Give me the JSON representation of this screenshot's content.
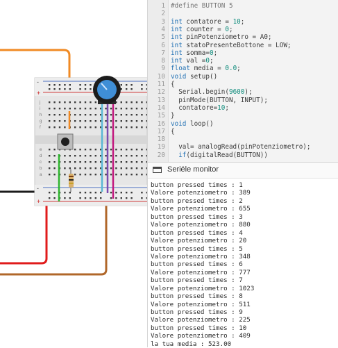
{
  "editor": {
    "lines": [
      {
        "num": "1",
        "parts": [
          {
            "t": "#define BUTTON 5",
            "c": "c"
          }
        ]
      },
      {
        "num": "2",
        "parts": []
      },
      {
        "num": "3",
        "parts": [
          {
            "t": "int",
            "c": "k"
          },
          {
            "t": " contatore = "
          },
          {
            "t": "10",
            "c": "n"
          },
          {
            "t": ";"
          }
        ]
      },
      {
        "num": "4",
        "parts": [
          {
            "t": "int",
            "c": "k"
          },
          {
            "t": " counter = "
          },
          {
            "t": "0",
            "c": "n"
          },
          {
            "t": ";"
          }
        ]
      },
      {
        "num": "5",
        "parts": [
          {
            "t": "int",
            "c": "k"
          },
          {
            "t": " pinPotenziometro = A0;"
          }
        ]
      },
      {
        "num": "6",
        "parts": [
          {
            "t": "int",
            "c": "k"
          },
          {
            "t": " statoPresenteBottone = LOW;"
          }
        ]
      },
      {
        "num": "7",
        "parts": [
          {
            "t": "int",
            "c": "k"
          },
          {
            "t": " somma="
          },
          {
            "t": "0",
            "c": "n"
          },
          {
            "t": ";"
          }
        ]
      },
      {
        "num": "8",
        "parts": [
          {
            "t": "int",
            "c": "k"
          },
          {
            "t": " val ="
          },
          {
            "t": "0",
            "c": "n"
          },
          {
            "t": ";"
          }
        ]
      },
      {
        "num": "9",
        "parts": [
          {
            "t": "float",
            "c": "k"
          },
          {
            "t": " media = "
          },
          {
            "t": "0.0",
            "c": "n"
          },
          {
            "t": ";"
          }
        ]
      },
      {
        "num": "10",
        "parts": [
          {
            "t": "void",
            "c": "k"
          },
          {
            "t": " setup()"
          }
        ]
      },
      {
        "num": "11",
        "parts": [
          {
            "t": "{"
          }
        ]
      },
      {
        "num": "12",
        "parts": [
          {
            "t": "  Serial.begin("
          },
          {
            "t": "9600",
            "c": "n"
          },
          {
            "t": ");"
          }
        ]
      },
      {
        "num": "13",
        "parts": [
          {
            "t": "  pinMode(BUTTON, INPUT);"
          }
        ]
      },
      {
        "num": "14",
        "parts": [
          {
            "t": "  contatore="
          },
          {
            "t": "10",
            "c": "n"
          },
          {
            "t": ";"
          }
        ]
      },
      {
        "num": "15",
        "parts": [
          {
            "t": "}"
          }
        ]
      },
      {
        "num": "16",
        "parts": [
          {
            "t": "void",
            "c": "k"
          },
          {
            "t": " loop()"
          }
        ]
      },
      {
        "num": "17",
        "parts": [
          {
            "t": "{"
          }
        ]
      },
      {
        "num": "18",
        "parts": []
      },
      {
        "num": "19",
        "parts": [
          {
            "t": "  val= analogRead(pinPotenziometro);"
          }
        ]
      },
      {
        "num": "20",
        "parts": [
          {
            "t": "  "
          },
          {
            "t": "if",
            "c": "k"
          },
          {
            "t": "(digitalRead(BUTTON))"
          }
        ]
      }
    ]
  },
  "monitor": {
    "title": "Seriële monitor",
    "icon": "serial-monitor-icon",
    "lines": [
      "button pressed times : 1",
      "Valore potenziometro : 389",
      "button pressed times : 2",
      "Valore potenziometro : 655",
      "button pressed times : 3",
      "Valore potenziometro : 880",
      "button pressed times : 4",
      "Valore potenziometro : 20",
      "button pressed times : 5",
      "Valore potenziometro : 348",
      "button pressed times : 6",
      "Valore potenziometro : 777",
      "button pressed times : 7",
      "Valore potenziometro : 1023",
      "button pressed times : 8",
      "Valore potenziometro : 511",
      "button pressed times : 9",
      "Valore potenziometro : 225",
      "button pressed times : 10",
      "Valore potenziometro : 409",
      "la tua media : 523.00"
    ]
  },
  "breadboard": {
    "row_letters_top": [
      "j",
      "i",
      "h",
      "g",
      "f"
    ],
    "row_letters_bottom": [
      "e",
      "d",
      "c",
      "b",
      "a"
    ],
    "plus": "+",
    "minus": "-"
  },
  "colors": {
    "wire_orange": "#f08a24",
    "wire_black": "#1b1b1b",
    "wire_red": "#e01b1b",
    "wire_brown": "#b0672a",
    "wire_green": "#2fb52f",
    "wire_cyan": "#5ab7d6",
    "wire_purple": "#7a4bb0",
    "wire_magenta": "#c2187e",
    "pot_knob": "#3f8ed6"
  }
}
